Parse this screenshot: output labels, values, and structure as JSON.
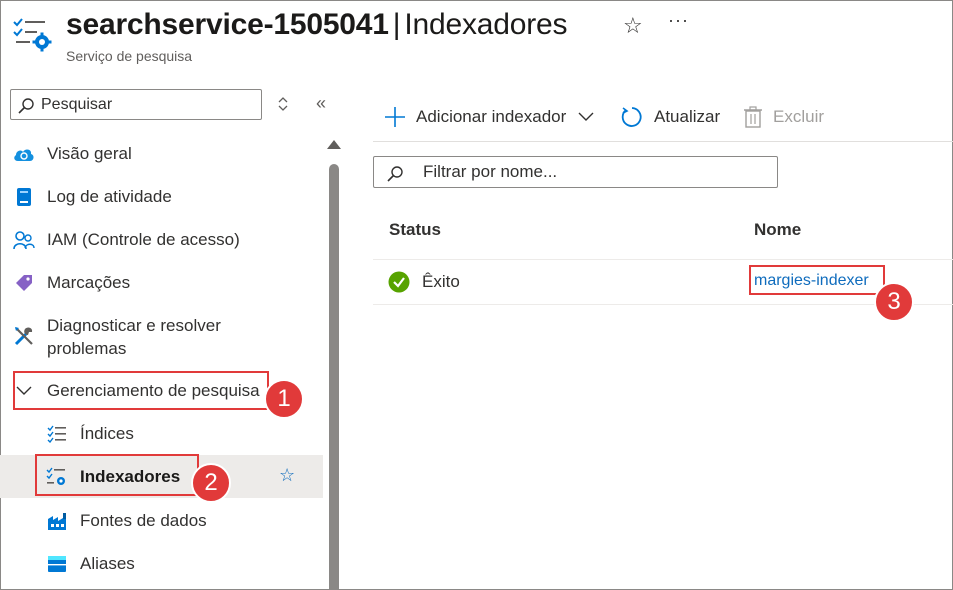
{
  "header": {
    "service_name": "searchservice-1505041",
    "separator": "|",
    "page_name": "Indexadores",
    "subtitle": "Serviço de pesquisa",
    "icon": "search-service-indexer-icon",
    "favorite_icon": "star-outline-icon",
    "more_icon": "ellipsis-icon",
    "more_label": "···"
  },
  "sidebar": {
    "search_placeholder": "Pesquisar",
    "collapse_label": "«",
    "items": [
      {
        "label": "Visão geral",
        "icon": "overview-cloud-icon"
      },
      {
        "label": "Log de atividade",
        "icon": "activity-log-icon"
      },
      {
        "label": "IAM (Controle de acesso)",
        "icon": "iam-people-icon"
      },
      {
        "label": "Marcações",
        "icon": "tag-icon"
      },
      {
        "label": "Diagnosticar e resolver problemas",
        "icon": "wrench-icon"
      },
      {
        "label": "Gerenciamento de pesquisa",
        "icon": "chevron-down-icon",
        "expanded": true
      },
      {
        "label": "Índices",
        "icon": "checklist-icon"
      },
      {
        "label": "Indexadores",
        "icon": "indexer-icon",
        "selected": true,
        "favorite_icon": "star-outline-icon"
      },
      {
        "label": "Fontes de dados",
        "icon": "data-source-factory-icon"
      },
      {
        "label": "Aliases",
        "icon": "aliases-icon"
      }
    ]
  },
  "toolbar": {
    "add_label": "Adicionar indexador",
    "refresh_label": "Atualizar",
    "delete_label": "Excluir",
    "delete_disabled": true
  },
  "filter": {
    "placeholder": "Filtrar por nome..."
  },
  "table": {
    "columns": [
      "Status",
      "Nome"
    ],
    "rows": [
      {
        "status": "Êxito",
        "status_icon": "success-check-icon",
        "name": "margies-indexer"
      }
    ]
  },
  "callouts": [
    "1",
    "2",
    "3"
  ],
  "colors": {
    "accent": "#0f6cbd",
    "callout": "#e13a3a",
    "success": "#57a300",
    "selected_bg": "#edebe9"
  }
}
